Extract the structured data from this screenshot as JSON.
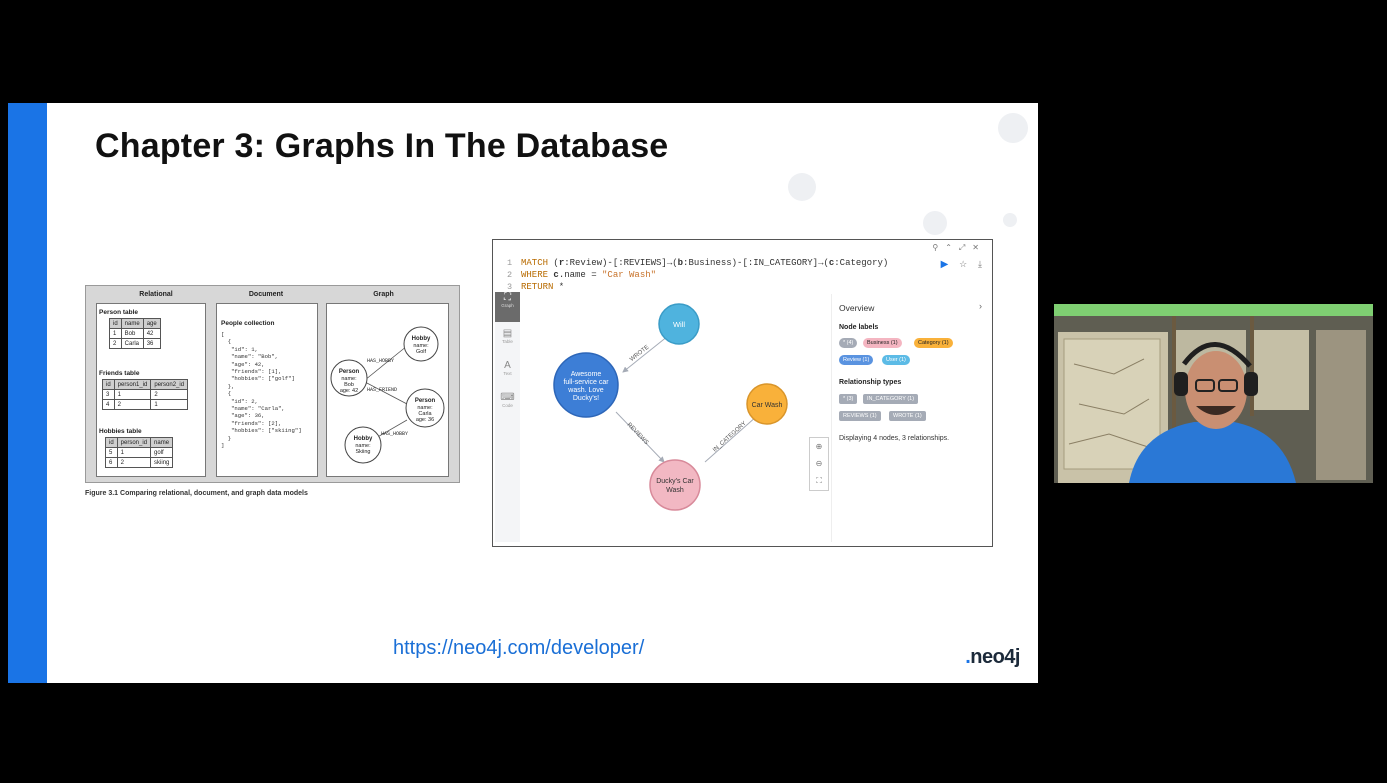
{
  "slide": {
    "title": "Chapter 3: Graphs In The Database",
    "url": "https://neo4j.com/developer/",
    "logo": "neo4j",
    "colors": {
      "bar": "#1a74e6",
      "title": "#111111",
      "link": "#1a6fd6"
    }
  },
  "figure": {
    "headers": [
      "Relational",
      "Document",
      "Graph"
    ],
    "person_table": {
      "title": "Person table",
      "columns": [
        "id",
        "name",
        "age"
      ],
      "rows": [
        [
          "1",
          "Bob",
          "42"
        ],
        [
          "2",
          "Carla",
          "36"
        ]
      ]
    },
    "friends_table": {
      "title": "Friends table",
      "columns": [
        "id",
        "person1_id",
        "person2_id"
      ],
      "rows": [
        [
          "3",
          "1",
          "2"
        ],
        [
          "4",
          "2",
          "1"
        ]
      ]
    },
    "hobbies_table": {
      "title": "Hobbies table",
      "columns": [
        "id",
        "person_id",
        "name"
      ],
      "rows": [
        [
          "5",
          "1",
          "golf"
        ],
        [
          "6",
          "2",
          "skiing"
        ]
      ]
    },
    "document": {
      "title": "People collection",
      "code": "[\n  {\n   \"id\": 1,\n   \"name\": \"Bob\",\n   \"age\": 42,\n   \"friends\": [1],\n   \"hobbies\": [\"golf\"]\n  },\n  {\n   \"id\": 2,\n   \"name\": \"Carla\",\n   \"age\": 36,\n   \"friends\": [2],\n   \"hobbies\": [\"skiing\"]\n  }\n]"
    },
    "graph": {
      "nodes": [
        {
          "label": "Person",
          "prop1": "name:",
          "prop2": "Bob",
          "prop3": "age: 42"
        },
        {
          "label": "Hobby",
          "prop1": "name:",
          "prop2": "Golf",
          "prop3": ""
        },
        {
          "label": "Person",
          "prop1": "name:",
          "prop2": "Carla",
          "prop3": "age: 36"
        },
        {
          "label": "Hobby",
          "prop1": "name:",
          "prop2": "Skiing",
          "prop3": ""
        }
      ],
      "edges": [
        "HAS_HOBBY",
        "HAS_FRIEND",
        "HAS_HOBBY"
      ]
    },
    "caption": "Figure 3.1   Comparing relational, document, and graph data models"
  },
  "browser": {
    "window_icons": [
      "pin-icon",
      "collapse-icon",
      "expand-icon",
      "close-icon"
    ],
    "query": {
      "line_numbers": [
        "1",
        "2",
        "3"
      ],
      "line1": {
        "a": "MATCH ",
        "b": "(",
        "c": "r",
        "d": ":Review)-[:REVIEWS]→(",
        "e": "b",
        "f": ":Business)-[:IN_CATEGORY]→(",
        "g": "c",
        "h": ":Category)"
      },
      "line2": {
        "a": "WHERE ",
        "b": "c",
        "c": ".name = ",
        "d": "\"Car Wash\""
      },
      "line3": {
        "a": "RETURN",
        "b": " *"
      }
    },
    "sidebar": [
      {
        "label": "Graph",
        "icon": "graph-icon"
      },
      {
        "label": "Table",
        "icon": "table-icon"
      },
      {
        "label": "Text",
        "icon": "text-icon"
      },
      {
        "label": "Code",
        "icon": "code-icon"
      }
    ],
    "result_graph": {
      "nodes": [
        {
          "label": "Will",
          "color": "#4fb3de",
          "stroke": "#3a9cc7"
        },
        {
          "label1": "Awesome",
          "label2": "full-service car",
          "label3": "wash. Love",
          "label4": "Ducky's!",
          "color": "#3d7ed6",
          "stroke": "#2d66b8"
        },
        {
          "label1": "Ducky's Car",
          "label2": "Wash",
          "color": "#f2b8c3",
          "stroke": "#d88a9a"
        },
        {
          "label": "Car Wash",
          "color": "#f9b13a",
          "stroke": "#d9952a"
        }
      ],
      "relationships": [
        "WROTE",
        "REVIEWS",
        "IN_CATEGORY"
      ]
    },
    "overview": {
      "title": "Overview",
      "node_labels_heading": "Node labels",
      "node_labels": [
        {
          "text": "* (4)",
          "color": "#a5abb6"
        },
        {
          "text": "Business (1)",
          "color": "#f4b5c1"
        },
        {
          "text": "Category (1)",
          "color": "#f9b13a"
        },
        {
          "text": "Review (1)",
          "color": "#5a93e0"
        },
        {
          "text": "User (1)",
          "color": "#5cbbe6"
        }
      ],
      "rel_types_heading": "Relationship types",
      "rel_types": [
        "* (3)",
        "IN_CATEGORY (1)",
        "REVIEWS (1)",
        "WROTE (1)"
      ],
      "status": "Displaying 4 nodes, 3 relationships."
    }
  }
}
